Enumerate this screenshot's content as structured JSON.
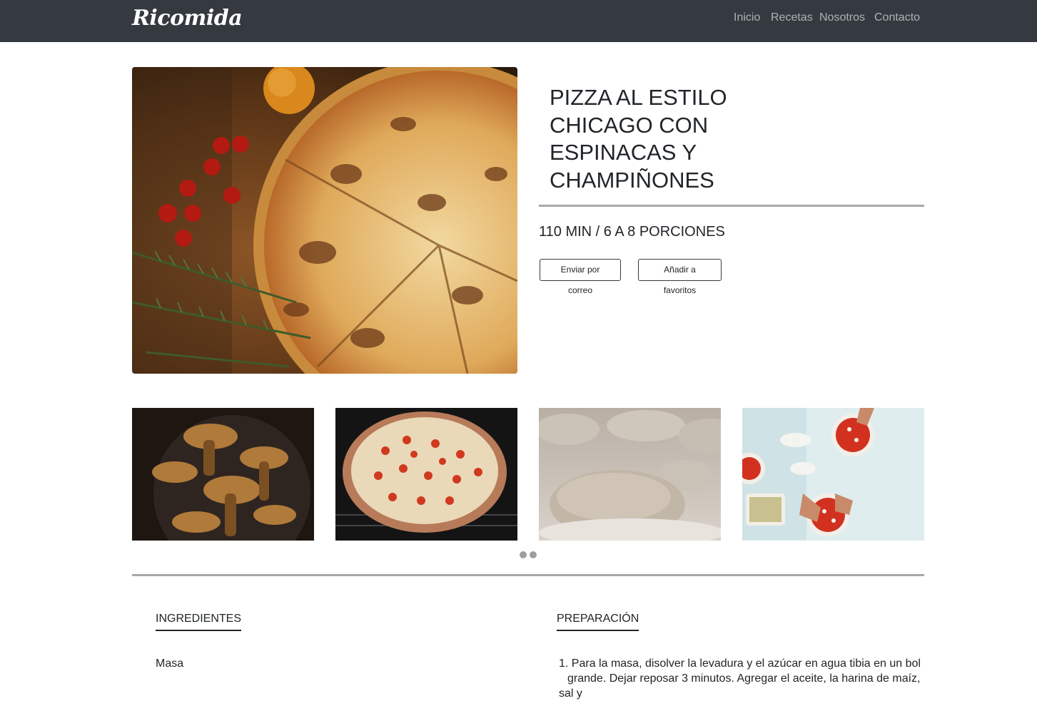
{
  "nav": {
    "brand": "Ricomida",
    "links": [
      "Inicio",
      "Recetas",
      "Nosotros",
      "Contacto"
    ]
  },
  "recipe": {
    "title_lines": [
      "PIZZA AL ESTILO",
      "CHICAGO CON",
      "ESPINACAS Y",
      "CHAMPIÑONES"
    ],
    "meta": "110 MIN / 6 A 8 PORCIONES",
    "buttons": {
      "email": "Enviar por correo",
      "favorite": "Añadir a favoritos"
    }
  },
  "gallery": {
    "images": [
      "mushrooms-photo",
      "pizza-oven-photo",
      "dough-photo",
      "pizza-making-photo"
    ],
    "dots": 2
  },
  "ingredients": {
    "heading": "INGREDIENTES",
    "first_group": "Masa"
  },
  "preparation": {
    "heading": "PREPARACIÓN",
    "step_1": "Para la masa, disolver la levadura y el azúcar en agua tibia en un bol",
    "step_1_cont": "grande. Dejar reposar 3 minutos. Agregar el aceite, la harina de maíz, sal y"
  },
  "colors": {
    "navbar": "#343a40",
    "rule": "#a8a8a8",
    "text": "#212529"
  }
}
